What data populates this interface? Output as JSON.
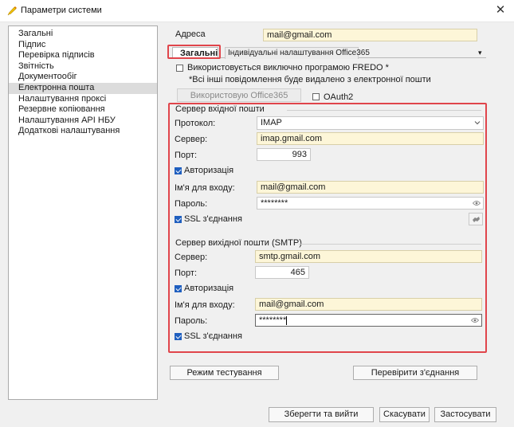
{
  "window": {
    "title": "Параметри системи",
    "close_symbol": "✕"
  },
  "nav": {
    "items": [
      {
        "label": "Загальні"
      },
      {
        "label": "Підпис"
      },
      {
        "label": "Перевірка підписів"
      },
      {
        "label": "Звітність"
      },
      {
        "label": "Документообіг"
      },
      {
        "label": "Електронна пошта",
        "selected": true
      },
      {
        "label": "Налаштування проксі"
      },
      {
        "label": "Резервне копіювання"
      },
      {
        "label": "Налаштування API НБУ"
      },
      {
        "label": "Додаткові налаштування"
      }
    ]
  },
  "address": {
    "label": "Адреса",
    "value": "mail@gmail.com"
  },
  "tabs": {
    "general": "Загальні",
    "office365": "Індивідуальні налаштування Office365",
    "scroll_symbol": "▾"
  },
  "fredo": {
    "label": "Використовується виключно програмою FREDO *",
    "checked": false,
    "note": "*Всі інші повідомлення буде видалено з електронної пошти"
  },
  "office365_button": "Використовую Office365",
  "oauth": {
    "label": "OAuth2",
    "checked": false
  },
  "incoming": {
    "title": "Сервер вхідної пошти",
    "protocol_label": "Протокол:",
    "protocol_value": "IMAP",
    "server_label": "Сервер:",
    "server_value": "imap.gmail.com",
    "port_label": "Порт:",
    "port_value": "993",
    "auth_label": "Авторизація",
    "auth_checked": true,
    "login_label": "Ім'я для входу:",
    "login_value": "mail@gmail.com",
    "password_label": "Пароль:",
    "password_value": "********",
    "ssl_label": "SSL з'єднання",
    "ssl_checked": true
  },
  "outgoing": {
    "title": "Сервер вихідної пошти (SMTP)",
    "server_label": "Сервер:",
    "server_value": "smtp.gmail.com",
    "port_label": "Порт:",
    "port_value": "465",
    "auth_label": "Авторизація",
    "auth_checked": true,
    "login_label": "Ім'я для входу:",
    "login_value": "mail@gmail.com",
    "password_label": "Пароль:",
    "password_value": "********",
    "ssl_label": "SSL з'єднання",
    "ssl_checked": true
  },
  "buttons": {
    "test_mode": "Режим тестування",
    "check_connection": "Перевірити з'єднання",
    "save_exit": "Зберегти та вийти",
    "cancel": "Скасувати",
    "apply": "Застосувати"
  },
  "colors": {
    "highlight": "#e0454b",
    "field_fill": "#fdf6d8",
    "checkbox": "#1f5fbf",
    "nav_selected": "#dcdcdc"
  }
}
